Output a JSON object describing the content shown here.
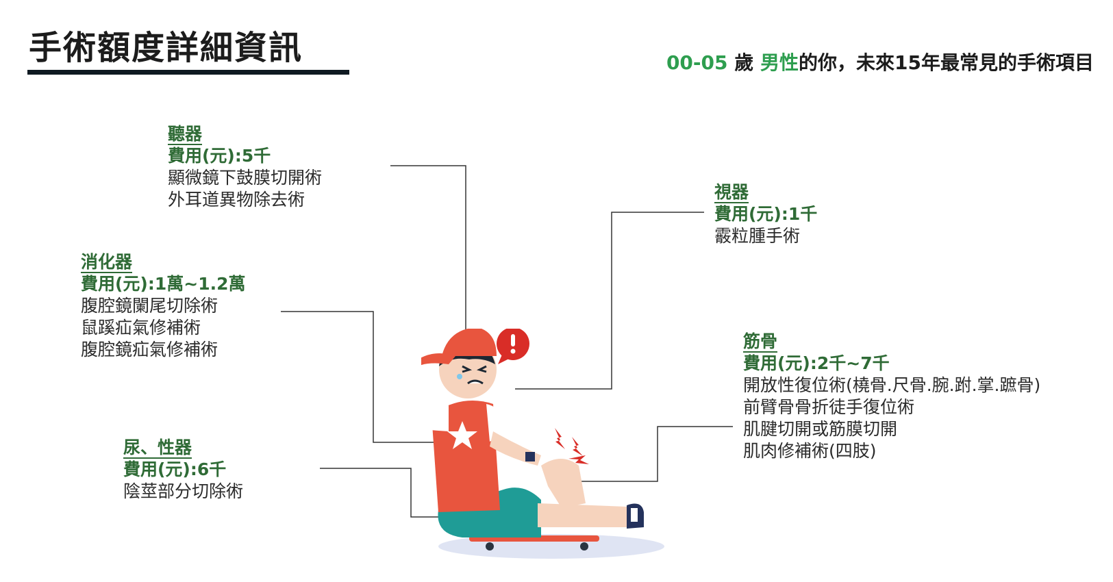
{
  "header": {
    "title": "手術額度詳細資訊",
    "age": "00-05",
    "age_unit": " 歲 ",
    "gender": "男性",
    "subtitle_rest": "的你，未來15年最常見的手術項目"
  },
  "blocks": {
    "ear": {
      "name": "聽器",
      "cost": "費用(元):5千",
      "items": [
        "顯微鏡下鼓膜切開術",
        "外耳道異物除去術"
      ]
    },
    "digestive": {
      "name": "消化器",
      "cost": "費用(元):1萬~1.2萬",
      "items": [
        "腹腔鏡闌尾切除術",
        "鼠蹊疝氣修補術",
        "腹腔鏡疝氣修補術"
      ]
    },
    "urinary": {
      "name": "尿、性器",
      "cost": "費用(元):6千",
      "items": [
        "陰莖部分切除術"
      ]
    },
    "eye": {
      "name": "視器",
      "cost": "費用(元):1千",
      "items": [
        "霰粒腫手術"
      ]
    },
    "bone": {
      "name": "筋骨",
      "cost": "費用(元):2千~7千",
      "items": [
        "開放性復位術(橈骨.尺骨.腕.跗.掌.蹠骨)",
        "前臂骨骨折徒手復位術",
        "肌腱切開或筋膜切開",
        "肌肉修補術(四肢)"
      ]
    }
  },
  "colors": {
    "accent_green": "#2e9e4f",
    "label_green": "#2f6b36",
    "cap_red": "#e8553e",
    "alert_red": "#d92d27"
  },
  "icons": {
    "illustration": "injured-boy-on-skateboard",
    "alert": "exclamation-bubble-icon"
  }
}
